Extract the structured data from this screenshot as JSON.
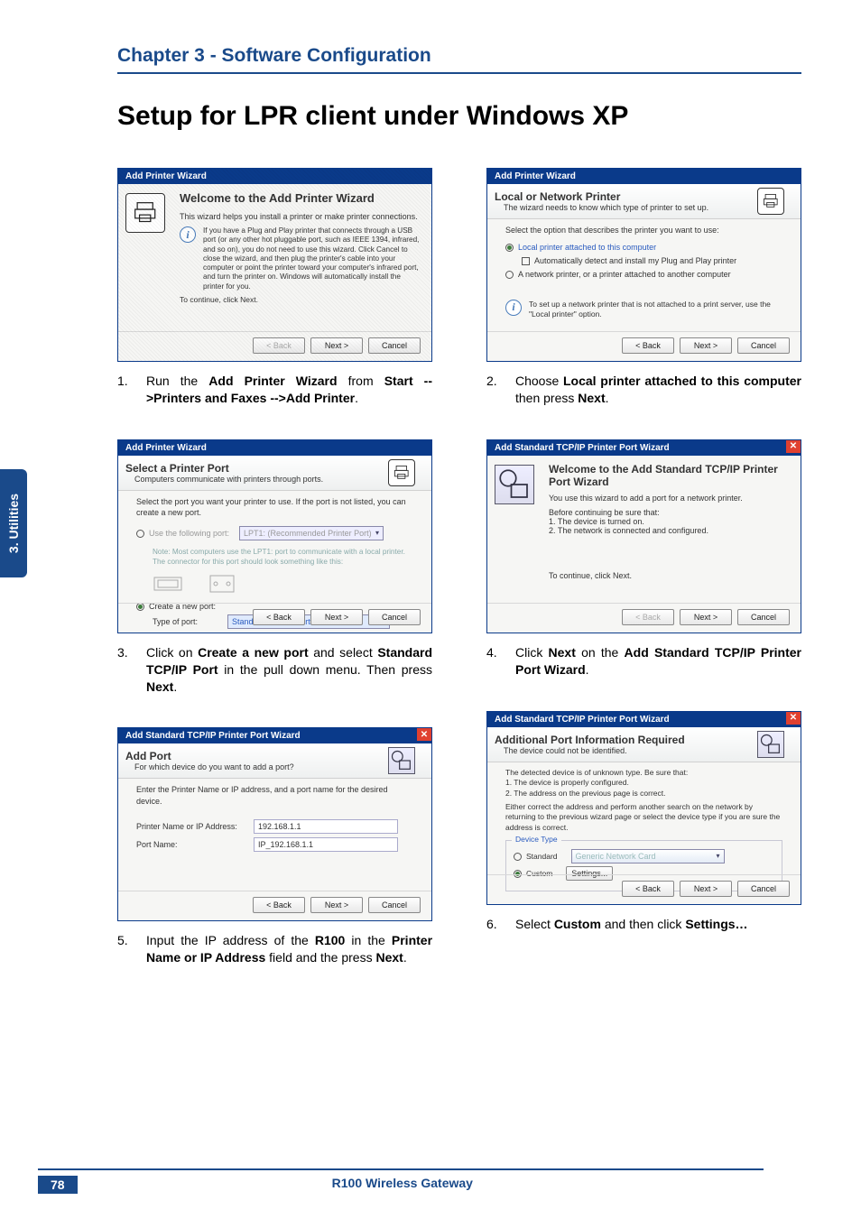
{
  "chapter": "Chapter 3 - Software Configuration",
  "title": "Setup for LPR client under Windows XP",
  "side_tab": "3. Utilities",
  "page_number": "78",
  "product": "R100 Wireless Gateway",
  "dialogs": {
    "d1": {
      "window_title": "Add Printer Wizard",
      "heading": "Welcome to the Add Printer Wizard",
      "intro": "This wizard helps you install a printer or make printer connections.",
      "info": "If you have a Plug and Play printer that connects through a USB port (or any other hot pluggable port, such as IEEE 1394, infrared, and so on), you do not need to use this wizard. Click Cancel to close the wizard, and then plug the printer's cable into your computer or point the printer toward your computer's infrared port, and turn the printer on. Windows will automatically install the printer for you.",
      "continue": "To continue, click Next.",
      "btn_back": "< Back",
      "btn_next": "Next >",
      "btn_cancel": "Cancel"
    },
    "d2": {
      "window_title": "Add Printer Wizard",
      "heading": "Local or Network Printer",
      "sub": "The wizard needs to know which type of printer to set up.",
      "prompt": "Select the option that describes the printer you want to use:",
      "opt1": "Local printer attached to this computer",
      "opt1_sub": "Automatically detect and install my Plug and Play printer",
      "opt2": "A network printer, or a printer attached to another computer",
      "info": "To set up a network printer that is not attached to a print server, use the \"Local printer\" option.",
      "btn_back": "< Back",
      "btn_next": "Next >",
      "btn_cancel": "Cancel"
    },
    "d3": {
      "window_title": "Add Printer Wizard",
      "heading": "Select a Printer Port",
      "sub": "Computers communicate with printers through ports.",
      "prompt": "Select the port you want your printer to use. If the port is not listed, you can create a new port.",
      "opt1": "Use the following port:",
      "opt1_val": "LPT1: (Recommended Printer Port)",
      "note": "Note: Most computers use the LPT1: port to communicate with a local printer. The connector for this port should look something like this:",
      "opt2": "Create a new port:",
      "opt2_label": "Type of port:",
      "opt2_val": "Standard TCP/IP Port",
      "btn_back": "< Back",
      "btn_next": "Next >",
      "btn_cancel": "Cancel"
    },
    "d4": {
      "window_title": "Add Standard TCP/IP Printer Port Wizard",
      "heading": "Welcome to the Add Standard TCP/IP Printer Port Wizard",
      "intro": "You use this wizard to add a port for a network printer.",
      "before": "Before continuing be sure that:",
      "b1": "1.  The device is turned on.",
      "b2": "2.  The network is connected and configured.",
      "continue": "To continue, click Next.",
      "btn_back": "< Back",
      "btn_next": "Next >",
      "btn_cancel": "Cancel"
    },
    "d5": {
      "window_title": "Add Standard TCP/IP Printer Port Wizard",
      "heading": "Add Port",
      "sub": "For which device do you want to add a port?",
      "prompt": "Enter the Printer Name or IP address, and a port name for the desired device.",
      "lbl1": "Printer Name or IP Address:",
      "val1": "192.168.1.1",
      "lbl2": "Port Name:",
      "val2": "IP_192.168.1.1",
      "btn_back": "< Back",
      "btn_next": "Next >",
      "btn_cancel": "Cancel"
    },
    "d6": {
      "window_title": "Add Standard TCP/IP Printer Port Wizard",
      "heading": "Additional Port Information Required",
      "sub": "The device could not be identified.",
      "msg1": "The detected device is of unknown type.  Be sure that:",
      "m1": "1. The device is properly configured.",
      "m2": "2. The address on the previous page is correct.",
      "msg2": "Either correct the address and perform another search on the network by returning to the previous wizard page or select the device type if you are sure the address is correct.",
      "grp": "Device Type",
      "opt1": "Standard",
      "opt1_val": "Generic Network Card",
      "opt2": "Custom",
      "btn_settings": "Settings...",
      "btn_back": "< Back",
      "btn_next": "Next >",
      "btn_cancel": "Cancel"
    }
  },
  "steps": {
    "s1": {
      "n": "1.",
      "pre": "Run the ",
      "b1": "Add Printer Wizard",
      "mid": " from ",
      "b2": "Start -->Printers and Faxes -->Add Printer",
      "post": "."
    },
    "s2": {
      "n": "2.",
      "pre": "Choose ",
      "b1": "Local printer attached to this computer",
      "mid": " then press ",
      "b2": "Next",
      "post": "."
    },
    "s3": {
      "n": "3.",
      "pre": "Click on ",
      "b1": "Create a new port",
      "mid": " and select ",
      "b2": "Standard TCP/IP Port",
      "mid2": " in the pull down menu. Then press ",
      "b3": "Next",
      "post": "."
    },
    "s4": {
      "n": "4.",
      "pre": "Click ",
      "b1": "Next",
      "mid": " on the ",
      "b2": "Add Standard TCP/IP Printer Port Wizard",
      "post": "."
    },
    "s5": {
      "n": "5.",
      "pre": "Input the IP address of the ",
      "b1": "R100",
      "mid": " in the ",
      "b2": "Printer Name or IP Address",
      "mid2": " field and the press ",
      "b3": "Next",
      "post": "."
    },
    "s6": {
      "n": "6.",
      "pre": "Select ",
      "b1": "Custom",
      "mid": " and then click ",
      "b2": "Settings…"
    }
  }
}
